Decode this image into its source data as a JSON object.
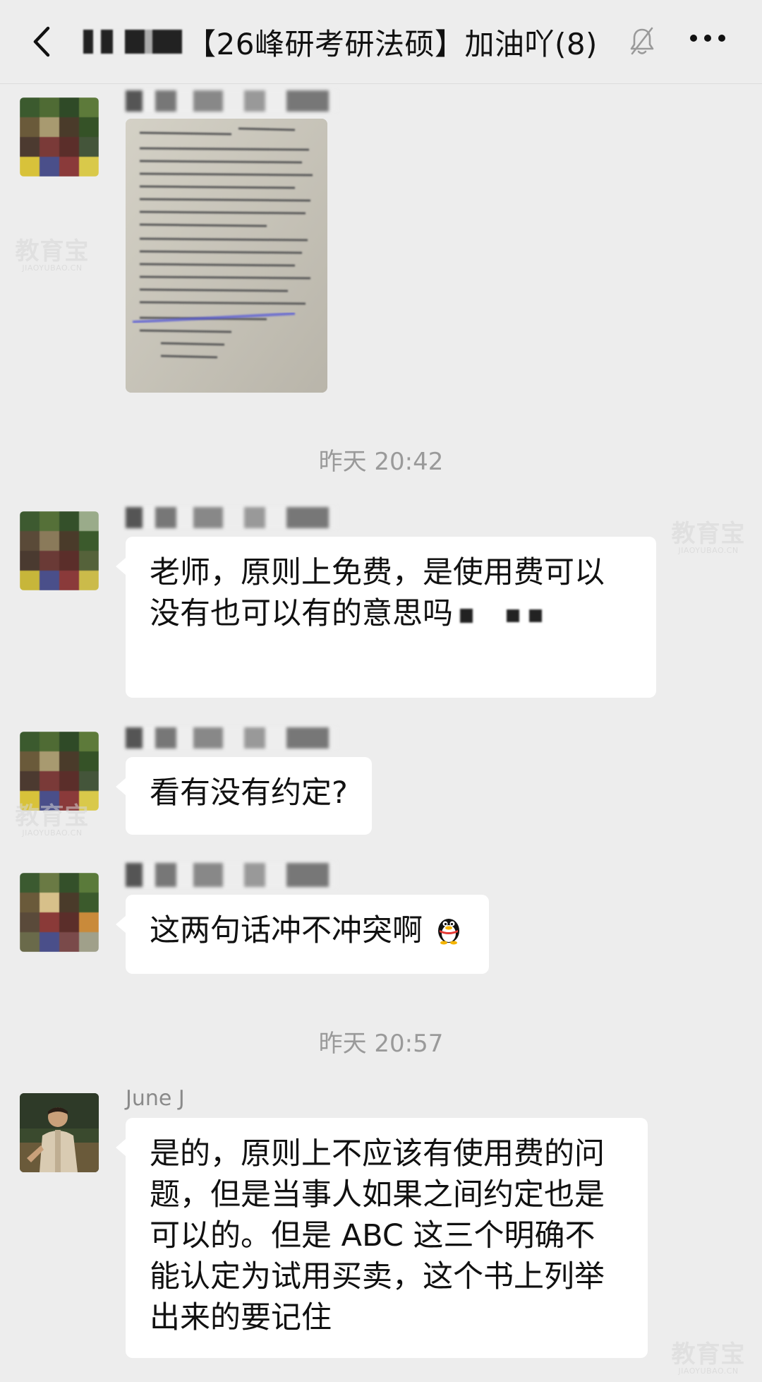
{
  "header": {
    "title": "【26峰研考研法硕】加油吖(8)",
    "back_icon": "chevron-left-icon",
    "mute_icon": "bell-off-icon",
    "more_icon": "more-dots-icon"
  },
  "watermark": {
    "main": "教育宝",
    "sub": "JIAOYUBAO.CN"
  },
  "timestamps": {
    "t1": "昨天 20:42",
    "t2": "昨天 20:57"
  },
  "messages": {
    "m1": {
      "type": "image"
    },
    "m2": {
      "text": "老师，原则上免费，是使用费可以没有也可以有的意思吗"
    },
    "m3": {
      "text": "看有没有约定?"
    },
    "m4": {
      "text": "这两句话冲不冲突啊",
      "emoji_icon": "penguin-emoji-icon"
    },
    "m5": {
      "sender": "June J",
      "text": "是的，原则上不应该有使用费的问题，但是当事人如果之间约定也是可以的。但是 ABC 这三个明确不能认定为试用买卖，这个书上列举出来的要记住"
    }
  }
}
